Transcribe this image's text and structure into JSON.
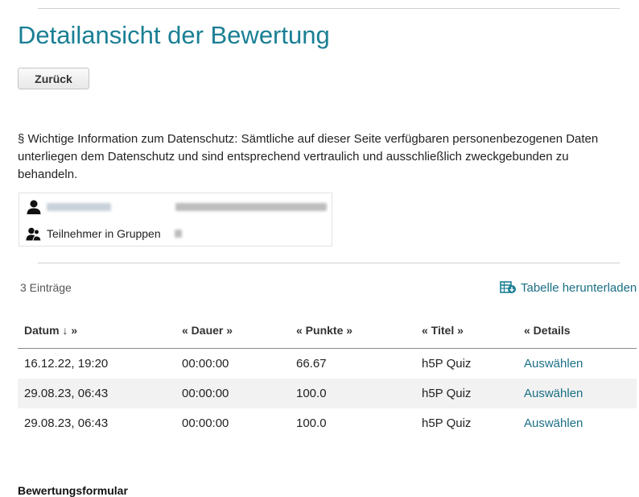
{
  "page": {
    "title": "Detailansicht der Bewertung",
    "back_label": "Zurück",
    "privacy_notice": "§ Wichtige Information zum Datenschutz: Sämtliche auf dieser Seite verfügbaren personenbezogenen Daten unterliegen dem Datenschutz und sind entsprechend vertraulich und ausschließlich zweckgebunden zu behandeln."
  },
  "info": {
    "user_icon": "user-icon",
    "groups_icon": "group-user-icon",
    "groups_label": "Teilnehmer in Gruppen"
  },
  "list": {
    "entries_count": "3 Einträge",
    "download_label": "Tabelle herunterladen",
    "download_icon": "table-download-icon"
  },
  "table": {
    "headers": {
      "date": "Datum ↓ »",
      "duration": "« Dauer »",
      "points": "« Punkte »",
      "title": "« Titel »",
      "details": "« Details"
    },
    "rows": [
      {
        "date": "16.12.22, 19:20",
        "duration": "00:00:00",
        "points": "66.67",
        "title": "h5P Quiz",
        "action": "Auswählen"
      },
      {
        "date": "29.08.23, 06:43",
        "duration": "00:00:00",
        "points": "100.0",
        "title": "h5P Quiz",
        "action": "Auswählen"
      },
      {
        "date": "29.08.23, 06:43",
        "duration": "00:00:00",
        "points": "100.0",
        "title": "h5P Quiz",
        "action": "Auswählen"
      }
    ]
  },
  "form": {
    "heading": "Bewertungsformular"
  },
  "colors": {
    "title": "#1a7f94",
    "link": "#1a6f85",
    "row_alt": "#f2f2f2"
  }
}
